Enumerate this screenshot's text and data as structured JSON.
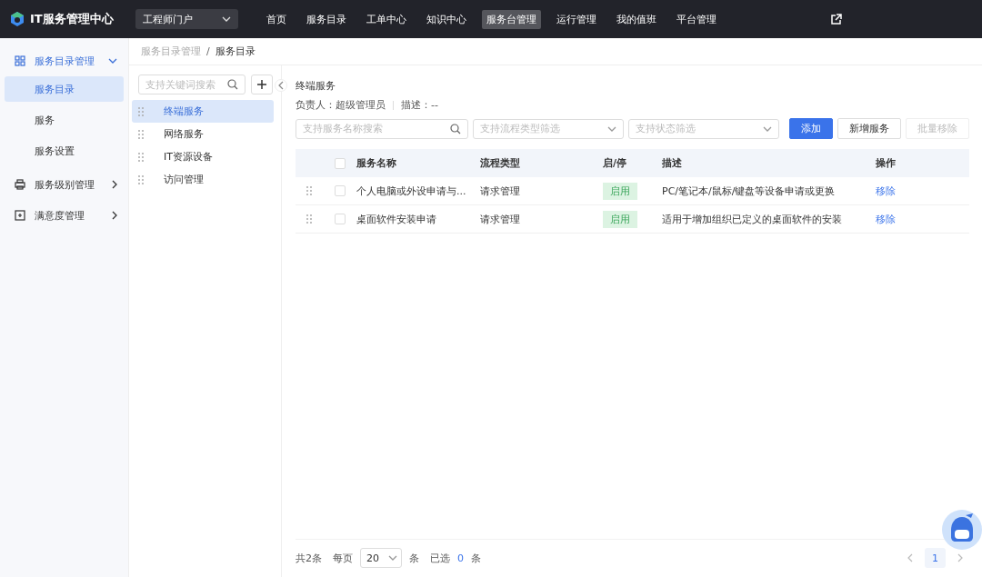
{
  "header": {
    "title": "IT服务管理中心",
    "portal": "工程师门户",
    "nav": [
      {
        "label": "首页",
        "selected": false
      },
      {
        "label": "服务目录",
        "selected": false
      },
      {
        "label": "工单中心",
        "selected": false
      },
      {
        "label": "知识中心",
        "selected": false
      },
      {
        "label": "服务台管理",
        "selected": true
      },
      {
        "label": "运行管理",
        "selected": false
      },
      {
        "label": "我的值班",
        "selected": false
      },
      {
        "label": "平台管理",
        "selected": false
      }
    ]
  },
  "sidebar": {
    "items": [
      {
        "label": "服务目录管理",
        "kind": "grid",
        "expanded": true,
        "children": [
          {
            "label": "服务目录",
            "selected": true
          },
          {
            "label": "服务",
            "selected": false
          },
          {
            "label": "服务设置",
            "selected": false
          }
        ]
      },
      {
        "label": "服务级别管理",
        "kind": "printer",
        "expanded": false
      },
      {
        "label": "满意度管理",
        "kind": "square",
        "expanded": false
      }
    ]
  },
  "breadcrumb": [
    "服务目录管理",
    "服务目录"
  ],
  "breadcrumb_separator": "/",
  "category_panel": {
    "placeholder": "支持关键词搜索",
    "categories": [
      {
        "label": "终端服务",
        "selected": true
      },
      {
        "label": "网络服务",
        "selected": false
      },
      {
        "label": "IT资源设备",
        "selected": false
      },
      {
        "label": "访问管理",
        "selected": false
      }
    ]
  },
  "detail": {
    "title": "终端服务",
    "owner": "负责人：超级管理员",
    "description": "描述：--"
  },
  "filters": [
    {
      "kind": "search",
      "placeholder": "支持服务名称搜索"
    },
    {
      "kind": "select",
      "placeholder": "支持流程类型筛选"
    },
    {
      "kind": "select",
      "placeholder": "支持状态筛选"
    }
  ],
  "buttons": [
    {
      "label": "添加",
      "kind": "primary"
    },
    {
      "label": "新增服务",
      "kind": "default"
    },
    {
      "label": "批量移除",
      "kind": "disabled"
    }
  ],
  "table": {
    "all_checked": false,
    "columns": [
      "服务名称",
      "流程类型",
      "启/停",
      "描述",
      "操作"
    ],
    "rows": [
      {
        "checked": false,
        "name": "个人电脑或外设申请与...",
        "process_type": "请求管理",
        "status": {
          "label": "启用",
          "on": true
        },
        "description": "PC/笔记本/鼠标/键盘等设备申请或更换",
        "action": "移除"
      },
      {
        "checked": false,
        "name": "桌面软件安装申请",
        "process_type": "请求管理",
        "status": {
          "label": "启用",
          "on": true
        },
        "description": "适用于增加组织已定义的桌面软件的安装",
        "action": "移除"
      }
    ]
  },
  "pagination": {
    "total": "共2条",
    "per_page": "每页",
    "page_size": "20",
    "unit": "条",
    "selected_label": "已选",
    "selected_count": "0",
    "selected_unit": "条",
    "pages": [
      {
        "label": "1",
        "selected": true
      }
    ]
  }
}
